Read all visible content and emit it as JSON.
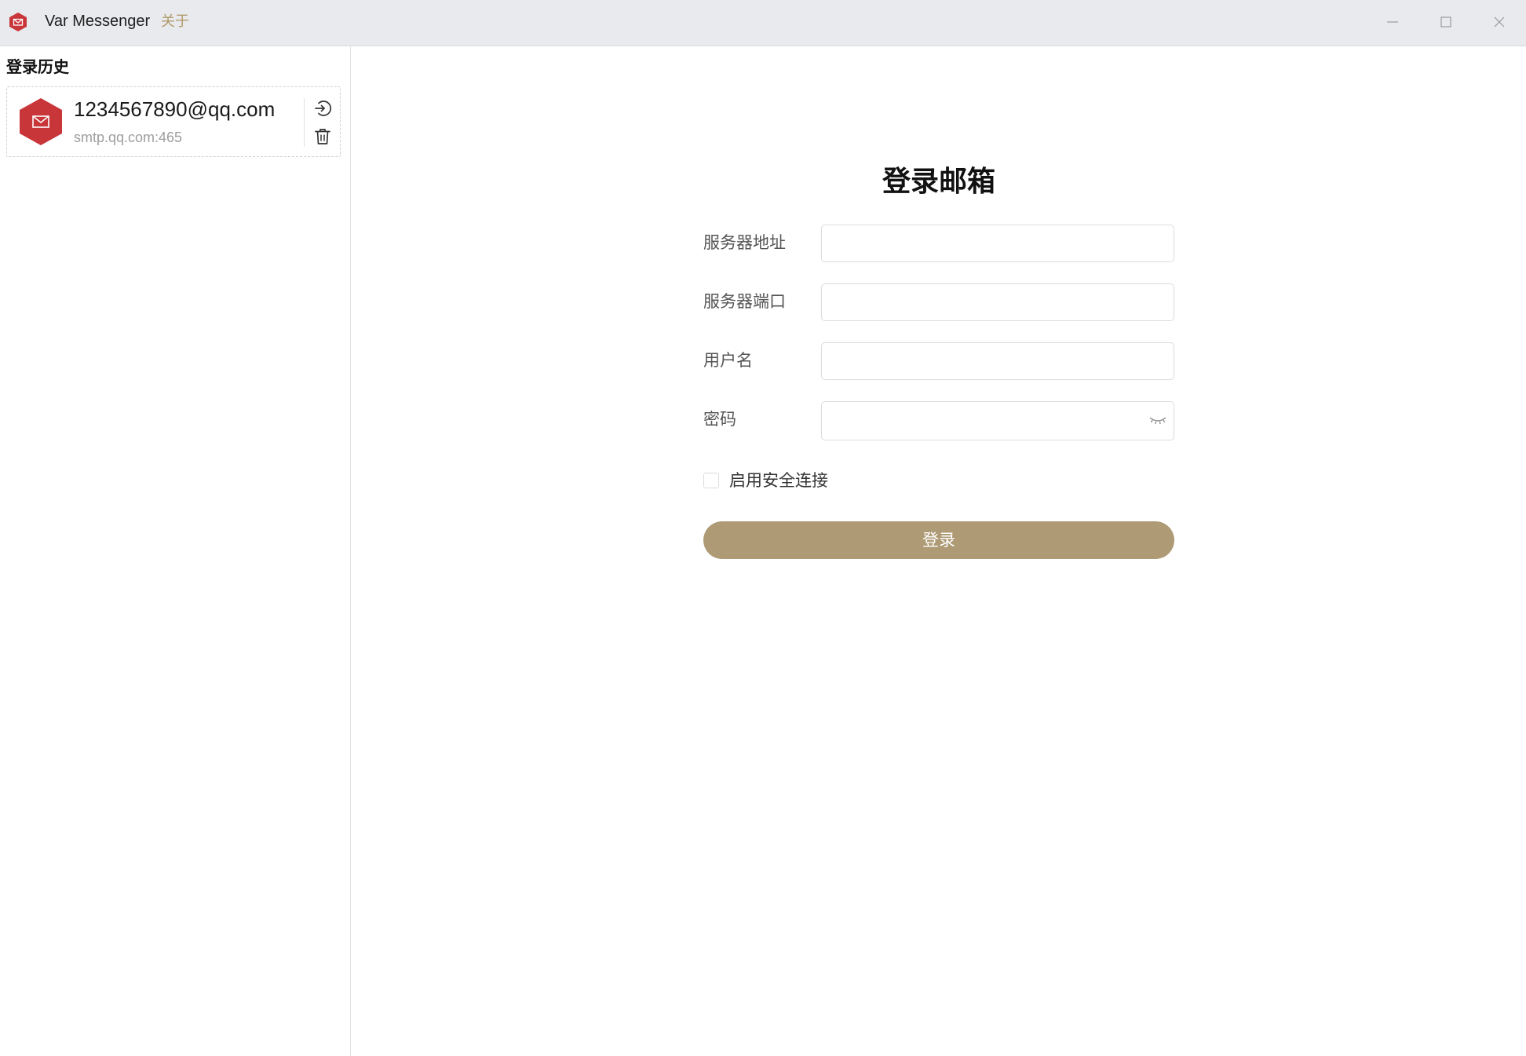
{
  "titlebar": {
    "app_title": "Var Messenger",
    "about_label": "关于",
    "logo_icon": "envelope-hexagon-icon",
    "controls": [
      "minimize-icon",
      "maximize-icon",
      "close-icon"
    ]
  },
  "sidebar": {
    "heading": "登录历史",
    "history": [
      {
        "email": "1234567890@qq.com",
        "server": "smtp.qq.com:465",
        "avatar_icon": "mail-icon",
        "actions": [
          "login-icon",
          "trash-icon"
        ]
      }
    ]
  },
  "form": {
    "title": "登录邮箱",
    "fields": [
      {
        "label": "服务器地址",
        "value": "",
        "placeholder": ""
      },
      {
        "label": "服务器端口",
        "value": "",
        "placeholder": ""
      },
      {
        "label": "用户名",
        "value": "",
        "placeholder": ""
      },
      {
        "label": "密码",
        "value": "",
        "placeholder": "",
        "toggle_icon": "eye-closed-icon"
      }
    ],
    "secure_connection_label": "启用安全连接",
    "secure_connection_checked": false,
    "submit_label": "登录"
  },
  "colors": {
    "accent": "#ae9a74",
    "about_link": "#b29a6a",
    "brand_red": "#c9363a",
    "titlebar_bg": "#e8eaee"
  }
}
